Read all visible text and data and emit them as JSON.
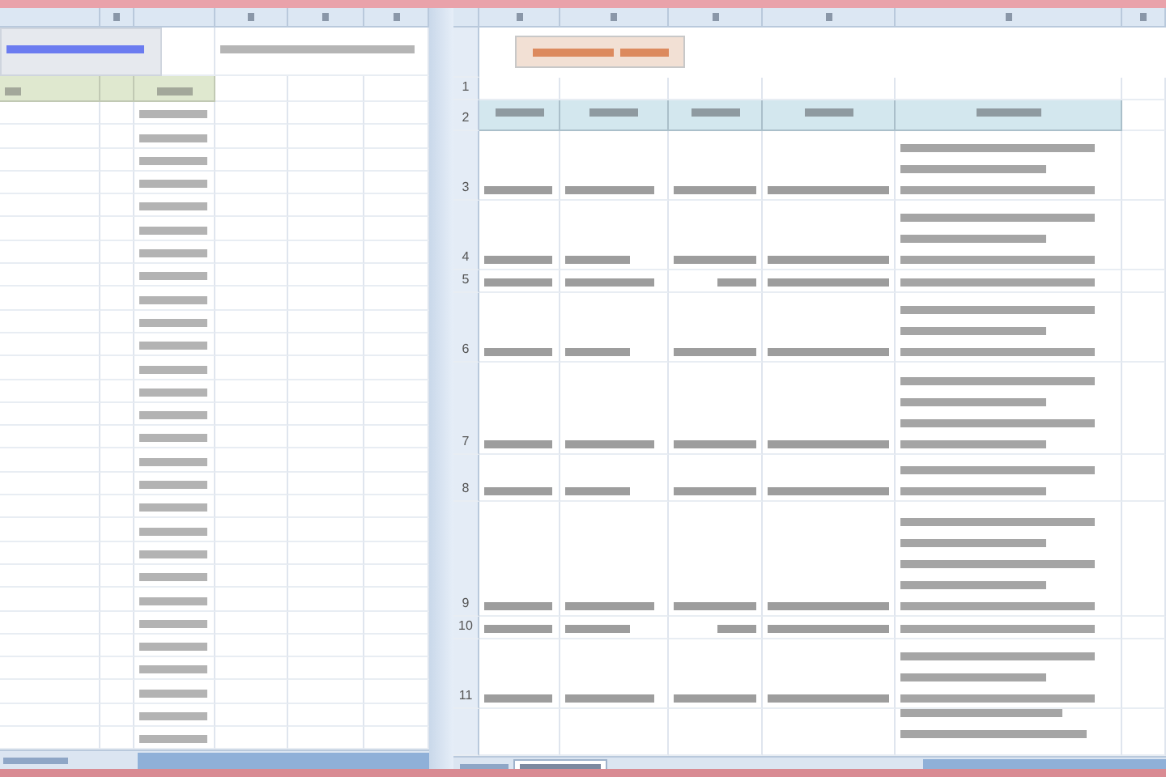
{
  "right_sheet": {
    "row_numbers": [
      "1",
      "2",
      "3",
      "4",
      "5",
      "6",
      "7",
      "8",
      "9",
      "10",
      "11"
    ]
  }
}
